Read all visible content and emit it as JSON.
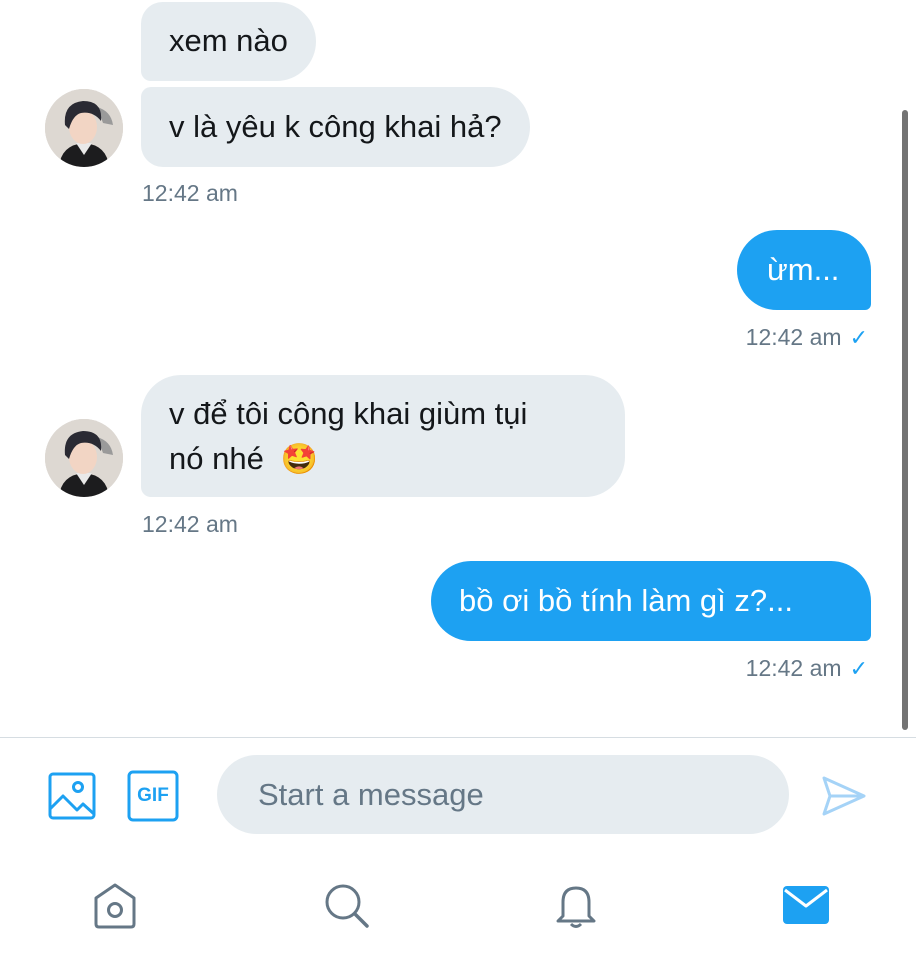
{
  "messages": [
    {
      "side": "in",
      "text": "xem nào"
    },
    {
      "side": "in",
      "text": "v là yêu k công khai hả?"
    },
    {
      "side": "out",
      "text": "ừm..."
    },
    {
      "side": "in",
      "text_line1": "v để tôi công khai giùm tụi",
      "text_line2": "nó nhé",
      "emoji": "🤩"
    },
    {
      "side": "out",
      "text": "bồ ơi bồ tính làm gì z?..."
    }
  ],
  "timestamps": [
    "12:42 am",
    "12:42 am",
    "12:42 am",
    "12:42 am"
  ],
  "read_check": "✓",
  "composer": {
    "placeholder": "Start a message",
    "gif_label": "GIF"
  },
  "colors": {
    "accent": "#1da1f2",
    "incoming_bubble": "#e6ecf0",
    "secondary_text": "#657786"
  },
  "icons": [
    "image-icon",
    "gif-icon",
    "send-icon",
    "home-icon",
    "search-icon",
    "bell-icon",
    "mail-icon"
  ]
}
